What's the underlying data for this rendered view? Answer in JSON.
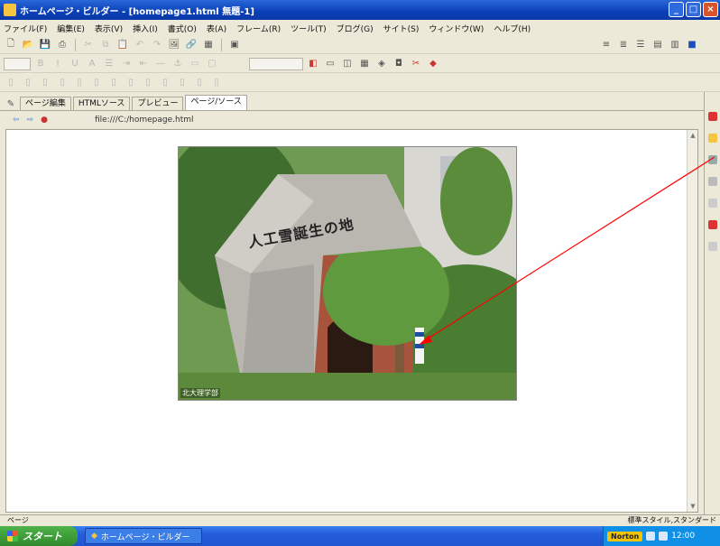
{
  "window": {
    "title": "ホームページ・ビルダー - [homepage1.html 無題-1]",
    "buttons": [
      "_",
      "□",
      "×"
    ]
  },
  "menubar": {
    "items": [
      "ファイル(F)",
      "編集(E)",
      "表示(V)",
      "挿入(I)",
      "書式(O)",
      "表(A)",
      "フレーム(R)",
      "ツール(T)",
      "ブログ(G)",
      "サイト(S)",
      "ウィンドウ(W)",
      "ヘルプ(H)"
    ]
  },
  "tabs": {
    "items": [
      "ページ編集",
      "HTMLソース",
      "プレビュー",
      "ページ/ソース"
    ]
  },
  "docbar": {
    "url": "file:///C:/homepage.html"
  },
  "photo": {
    "inscription": "人工雪誕生の地",
    "caption": "北大理学部"
  },
  "status": {
    "left": "ページ",
    "right": "標準スタイル,スタンダード"
  },
  "taskbar": {
    "start_label": "スタート",
    "task_item": "ホームページ・ビルダー",
    "norton": "Norton",
    "clock": "12:00"
  },
  "colors": {
    "titlebar": "#0a3fb8",
    "annotation_arrow": "#ff0000"
  }
}
